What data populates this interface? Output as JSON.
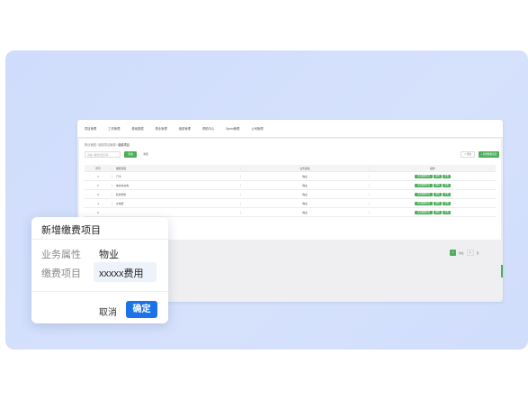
{
  "topnav": {
    "items": [
      "项目管理",
      "工作管理",
      "基础数据",
      "物业管理",
      "缴费管理",
      "帮助中心",
      "Sprint管理",
      "公司管理"
    ]
  },
  "breadcrumb": {
    "items": [
      "物业管理",
      "缴费项目管理"
    ],
    "current": "缴费项目"
  },
  "toolbar": {
    "search_placeholder": "请输入缴费项目名称",
    "search_label": "查询",
    "reset_label": "重置",
    "export_label": "导出",
    "add_label": "新增缴费项目"
  },
  "table": {
    "headers": [
      "序号",
      "缴费项目",
      "业务属性",
      "操作"
    ],
    "rows": [
      {
        "no": "1",
        "item": "门卡",
        "type": "物业"
      },
      {
        "no": "2",
        "item": "电动车充电",
        "type": "物业"
      },
      {
        "no": "3",
        "item": "装修押金",
        "type": "物业"
      },
      {
        "no": "4",
        "item": "水电费",
        "type": "物业"
      },
      {
        "no": "5",
        "item": "",
        "type": "物业"
      }
    ],
    "actions": [
      "修改缴费项目",
      "删除",
      "查看"
    ]
  },
  "pager": {
    "current": "1",
    "goto_label": "前往",
    "goto_value": "1",
    "unit": "页"
  },
  "dialog": {
    "title": "新增缴费项目",
    "business_label": "业务属性",
    "business_value": "物业",
    "fee_label": "缴费项目",
    "fee_value": "xxxxx费用",
    "cancel_label": "取消",
    "confirm_label": "确定"
  },
  "colors": {
    "accent_green": "#4cae5b",
    "primary_blue": "#1a73e8",
    "stage_bg": "#d3dffb"
  }
}
